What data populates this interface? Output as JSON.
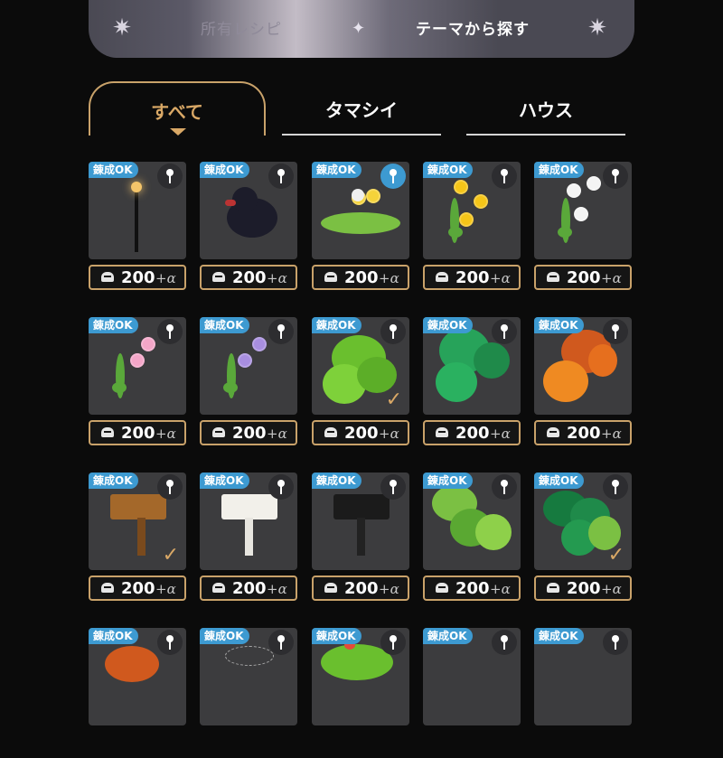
{
  "top_tabs": {
    "owned_label": "所有レシピ",
    "theme_label": "テーマから探す"
  },
  "category_tabs": [
    {
      "label": "すべて",
      "selected": true
    },
    {
      "label": "タマシイ",
      "selected": false
    },
    {
      "label": "ハウス",
      "selected": false
    }
  ],
  "items": [
    {
      "badge": "錬成OK",
      "price": "200",
      "extra": "+α",
      "art": "lamp",
      "checked": false,
      "pin_active": false
    },
    {
      "badge": "錬成OK",
      "price": "200",
      "extra": "+α",
      "art": "duck",
      "checked": false,
      "pin_active": false
    },
    {
      "badge": "錬成OK",
      "price": "200",
      "extra": "+α",
      "art": "dandelion",
      "checked": false,
      "pin_active": true
    },
    {
      "badge": "錬成OK",
      "price": "200",
      "extra": "+α",
      "art": "vine-yellow",
      "checked": false,
      "pin_active": false
    },
    {
      "badge": "錬成OK",
      "price": "200",
      "extra": "+α",
      "art": "vine-white",
      "checked": false,
      "pin_active": false
    },
    {
      "badge": "錬成OK",
      "price": "200",
      "extra": "+α",
      "art": "vine-pink",
      "checked": false,
      "pin_active": false
    },
    {
      "badge": "錬成OK",
      "price": "200",
      "extra": "+α",
      "art": "vine-purple",
      "checked": false,
      "pin_active": false
    },
    {
      "badge": "錬成OK",
      "price": "200",
      "extra": "+α",
      "art": "bush-lightgreen",
      "checked": true,
      "pin_active": false
    },
    {
      "badge": "錬成OK",
      "price": "200",
      "extra": "+α",
      "art": "bush-darkgreen",
      "checked": false,
      "pin_active": false
    },
    {
      "badge": "錬成OK",
      "price": "200",
      "extra": "+α",
      "art": "bush-orange",
      "checked": false,
      "pin_active": false
    },
    {
      "badge": "錬成OK",
      "price": "200",
      "extra": "+α",
      "art": "sign-brown",
      "checked": true,
      "pin_active": false
    },
    {
      "badge": "錬成OK",
      "price": "200",
      "extra": "+α",
      "art": "sign-white",
      "checked": false,
      "pin_active": false
    },
    {
      "badge": "錬成OK",
      "price": "200",
      "extra": "+α",
      "art": "sign-black",
      "checked": false,
      "pin_active": false
    },
    {
      "badge": "錬成OK",
      "price": "200",
      "extra": "+α",
      "art": "bush-green",
      "checked": false,
      "pin_active": false
    },
    {
      "badge": "錬成OK",
      "price": "200",
      "extra": "+α",
      "art": "bush-mixgreen",
      "checked": true,
      "pin_active": false
    },
    {
      "badge": "錬成OK",
      "art": "partial-orange",
      "checked": false,
      "pin_active": false
    },
    {
      "badge": "錬成OK",
      "art": "partial-web",
      "checked": false,
      "pin_active": false
    },
    {
      "badge": "錬成OK",
      "art": "partial-green",
      "checked": false,
      "pin_active": false
    },
    {
      "badge": "錬成OK",
      "art": "partial-none",
      "checked": false,
      "pin_active": false
    },
    {
      "badge": "錬成OK",
      "art": "partial-none",
      "checked": false,
      "pin_active": false
    }
  ],
  "colors": {
    "accent_gold": "#c9a26a",
    "badge_blue": "#3d9ad1",
    "card_bg": "#3c3c3e"
  }
}
